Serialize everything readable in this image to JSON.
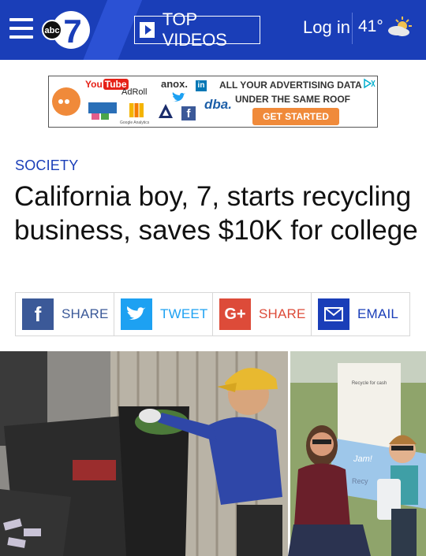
{
  "header": {
    "logo_text": "abc",
    "logo_number": "7",
    "top_videos_label": "TOP VIDEOS",
    "login_label": "Log in",
    "temperature": "41°",
    "weather_icon": "partly-cloudy-icon",
    "colors": {
      "bar": "#1a3eb8"
    }
  },
  "ad": {
    "brands": [
      "YouTube",
      "AdRoll",
      "anox.",
      "dba."
    ],
    "youtube_you": "You",
    "youtube_tube": "Tube",
    "adroll": "AdRoll",
    "anox": "anox.",
    "dba": "dba.",
    "headline_line1": "ALL YOUR ADVERTISING DATA",
    "headline_line2": "UNDER THE SAME ROOF",
    "cta_label": "GET STARTED",
    "small_text": "Google Analytics",
    "accent_color": "#f08a3a"
  },
  "article": {
    "section": "SOCIETY",
    "title": "California boy, 7, starts recycling business, saves $10K for college"
  },
  "share": [
    {
      "icon": "facebook-icon",
      "label": "SHARE",
      "color": "#3b5998"
    },
    {
      "icon": "twitter-icon",
      "label": "TWEET",
      "color": "#1da1f2"
    },
    {
      "icon": "google-plus-icon",
      "label": "SHARE",
      "color": "#dd4b39"
    },
    {
      "icon": "email-icon",
      "label": "EMAIL",
      "color": "#1a3eb8"
    }
  ],
  "photo": {
    "sign_text": "Recycle for cash",
    "bag_text": "Jam!",
    "banner_text": "Recy"
  }
}
